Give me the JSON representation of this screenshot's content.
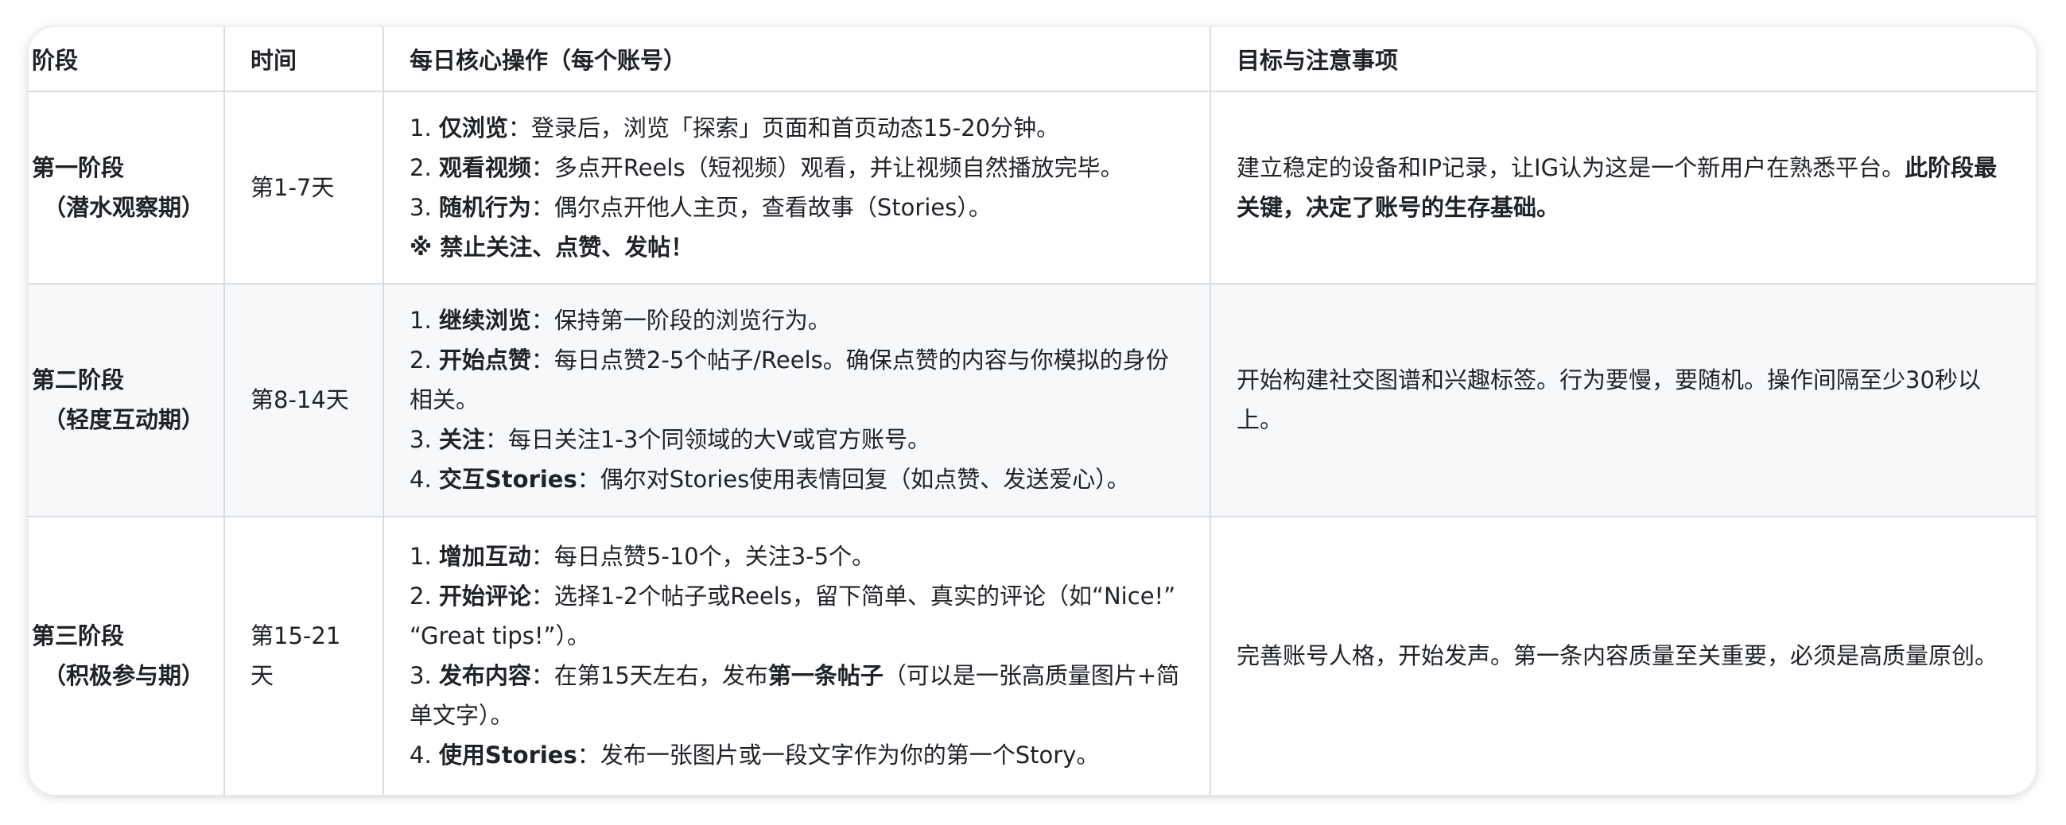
{
  "table": {
    "headers": [
      "阶段",
      "时间",
      "每日核心操作（每个账号）",
      "目标与注意事项"
    ],
    "rows": [
      {
        "stage": "第一阶段",
        "stage_sub": "（潜水观察期）",
        "time": "第1-7天",
        "ops": [
          {
            "num": "1. ",
            "bold": "仅浏览",
            "text": "：登录后，浏览「探索」页面和首页动态15-20分钟。"
          },
          {
            "num": "2. ",
            "bold": "观看视频",
            "text": "：多点开Reels（短视频）观看，并让视频自然播放完毕。"
          },
          {
            "num": "3. ",
            "bold": "随机行为",
            "text": "：偶尔点开他人主页，查看故事（Stories）。"
          },
          {
            "num": "",
            "bold": "※ 禁止关注、点赞、发帖！",
            "text": ""
          }
        ],
        "goal_text": "建立稳定的设备和IP记录，让IG认为这是一个新用户在熟悉平台。",
        "goal_bold": "此阶段最关键，决定了账号的生存基础。"
      },
      {
        "stage": "第二阶段",
        "stage_sub": "（轻度互动期）",
        "time": "第8-14天",
        "ops": [
          {
            "num": "1. ",
            "bold": "继续浏览",
            "text": "：保持第一阶段的浏览行为。"
          },
          {
            "num": "2. ",
            "bold": "开始点赞",
            "text": "：每日点赞2-5个帖子/Reels。确保点赞的内容与你模拟的身份相关。"
          },
          {
            "num": "3. ",
            "bold": "关注",
            "text": "：每日关注1-3个同领域的大V或官方账号。"
          },
          {
            "num": "4. ",
            "bold": "交互Stories",
            "text": "：偶尔对Stories使用表情回复（如点赞、发送爱心）。"
          }
        ],
        "goal_text": "开始构建社交图谱和兴趣标签。行为要慢，要随机。操作间隔至少30秒以上。",
        "goal_bold": ""
      },
      {
        "stage": "第三阶段",
        "stage_sub": "（积极参与期）",
        "time": "第15-21天",
        "ops": [
          {
            "num": "1. ",
            "bold": "增加互动",
            "text": "：每日点赞5-10个，关注3-5个。"
          },
          {
            "num": "2. ",
            "bold": "开始评论",
            "text": "：选择1-2个帖子或Reels，留下简单、真实的评论（如“Nice!” “Great tips!”）。"
          },
          {
            "num": "3. ",
            "bold": "发布内容",
            "text": "：在第15天左右，发布",
            "bold2": "第一条帖子",
            "text2": "（可以是一张高质量图片+简单文字）。"
          },
          {
            "num": "4. ",
            "bold": "使用Stories",
            "text": "：发布一张图片或一段文字作为你的第一个Story。"
          }
        ],
        "goal_text": "完善账号人格，开始发声。第一条内容质量至关重要，必须是高质量原创。",
        "goal_bold": ""
      }
    ]
  }
}
